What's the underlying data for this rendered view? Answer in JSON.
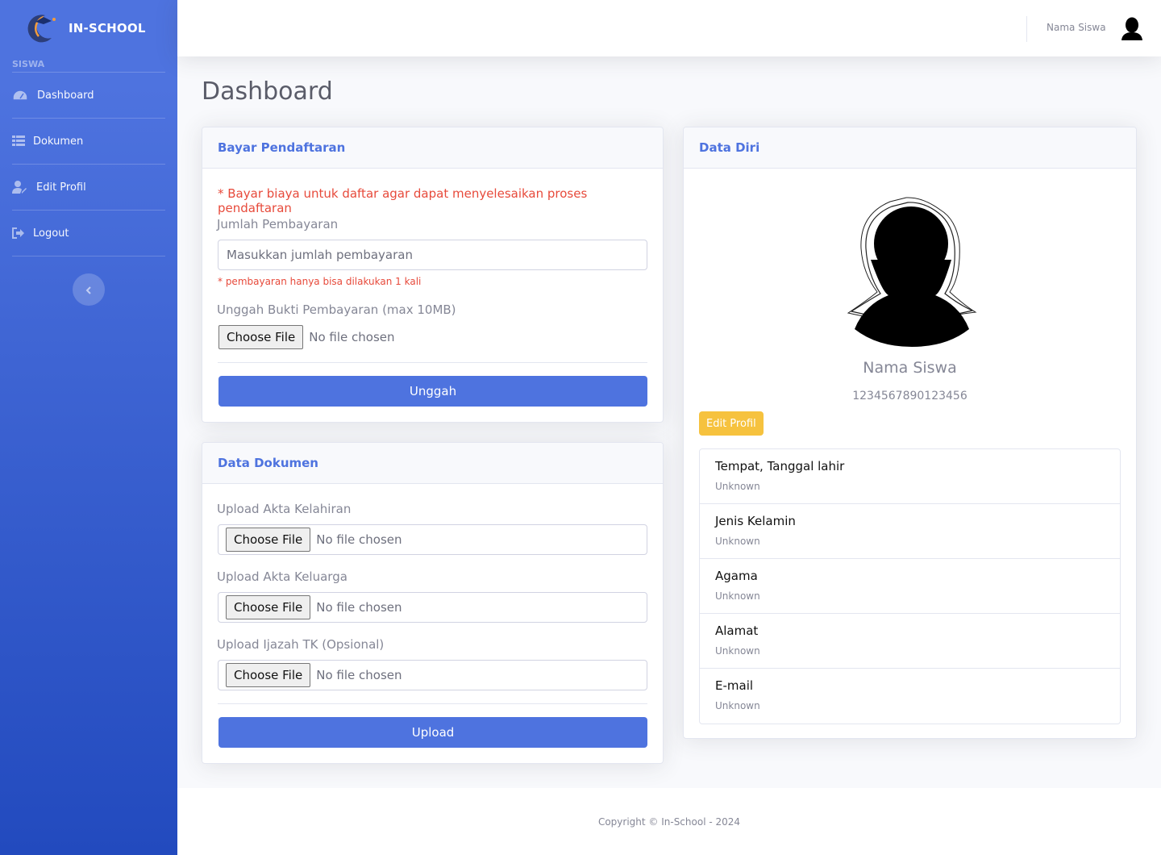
{
  "brand": {
    "name": "IN-SCHOOL"
  },
  "sidebar": {
    "heading": "SISWA",
    "items": [
      {
        "label": "Dashboard",
        "icon": "tachometer-icon"
      },
      {
        "label": "Dokumen",
        "icon": "table-icon"
      },
      {
        "label": "Edit Profil",
        "icon": "user-edit-icon"
      },
      {
        "label": "Logout",
        "icon": "sign-out-icon"
      }
    ],
    "toggle_icon": "chevron-left-icon"
  },
  "topbar": {
    "user_name": "Nama Siswa",
    "avatar_icon": "user-silhouette-icon"
  },
  "page": {
    "title": "Dashboard"
  },
  "bayar": {
    "header": "Bayar Pendaftaran",
    "notice": "* Bayar biaya untuk daftar agar dapat menyelesaikan proses pendaftaran",
    "amount_label": "Jumlah Pembayaran",
    "amount_placeholder": "Masukkan jumlah pembayaran",
    "amount_note": "* pembayaran hanya bisa dilakukan 1 kali",
    "proof_label": "Unggah Bukti Pembayaran (max 10MB)",
    "file_button": "Choose File",
    "file_status": "No file chosen",
    "submit_label": "Unggah"
  },
  "dokumen": {
    "header": "Data Dokumen",
    "fields": [
      {
        "label": "Upload Akta Kelahiran",
        "button": "Choose File",
        "status": "No file chosen"
      },
      {
        "label": "Upload Akta Keluarga",
        "button": "Choose File",
        "status": "No file chosen"
      },
      {
        "label": "Upload Ijazah TK (Opsional)",
        "button": "Choose File",
        "status": "No file chosen"
      }
    ],
    "submit_label": "Upload"
  },
  "profile": {
    "header": "Data Diri",
    "name": "Nama Siswa",
    "id_number": "1234567890123456",
    "edit_label": "Edit Profil",
    "details": [
      {
        "title": "Tempat, Tanggal lahir",
        "value": "Unknown"
      },
      {
        "title": "Jenis Kelamin",
        "value": "Unknown"
      },
      {
        "title": "Agama",
        "value": "Unknown"
      },
      {
        "title": "Alamat",
        "value": "Unknown"
      },
      {
        "title": "E-mail",
        "value": "Unknown"
      }
    ]
  },
  "footer": {
    "copyright": "Copyright © In-School - 2024"
  },
  "colors": {
    "primary": "#4e73df",
    "warning": "#f6c23e",
    "danger": "#e74a3b"
  }
}
